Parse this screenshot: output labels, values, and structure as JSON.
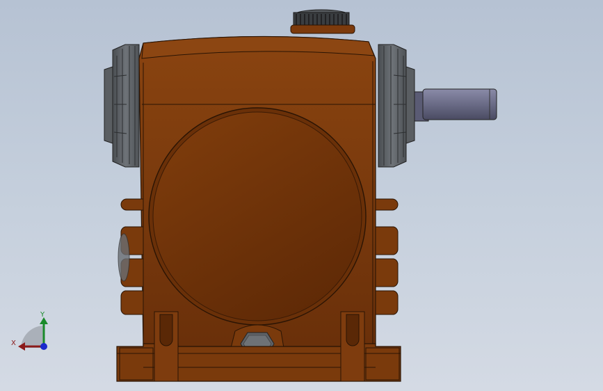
{
  "viewport": {
    "background_top": "#b6c2d3",
    "background_bottom": "#d4dae4"
  },
  "model": {
    "body_color": "#7a3a0c",
    "cover_color": "#6f3209",
    "bearing_cap_color": "#5c6166",
    "shaft_color": "#6e6f88",
    "edge_color": "#2a1404"
  },
  "triad": {
    "x_label": "X",
    "y_label": "Y",
    "x_color": "#8b1a1a",
    "y_color": "#1a8a2a",
    "z_color": "#1a2acc"
  }
}
